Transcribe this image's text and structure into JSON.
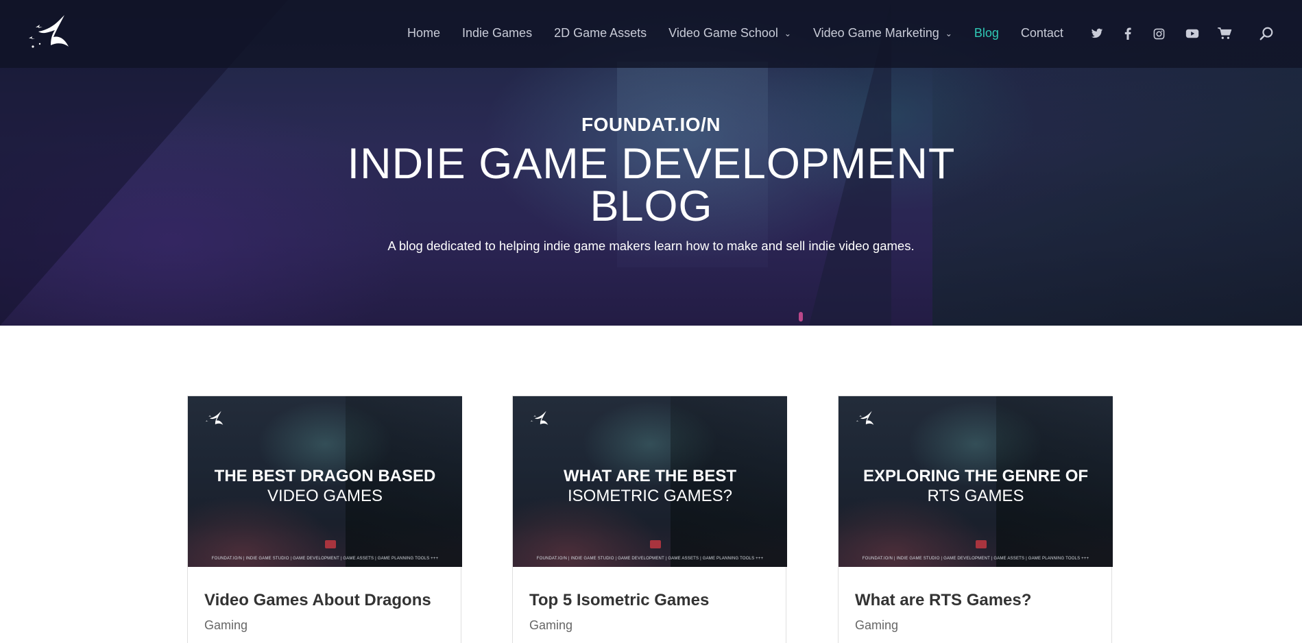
{
  "nav": {
    "items": [
      {
        "label": "Home",
        "has_dropdown": false,
        "active": false
      },
      {
        "label": "Indie Games",
        "has_dropdown": false,
        "active": false
      },
      {
        "label": "2D Game Assets",
        "has_dropdown": false,
        "active": false
      },
      {
        "label": "Video Game School",
        "has_dropdown": true,
        "active": false
      },
      {
        "label": "Video Game Marketing",
        "has_dropdown": true,
        "active": false
      },
      {
        "label": "Blog",
        "has_dropdown": false,
        "active": true
      },
      {
        "label": "Contact",
        "has_dropdown": false,
        "active": false
      }
    ],
    "chevron": "chevron-down-icon",
    "social_icons": [
      "twitter-icon",
      "facebook-icon",
      "instagram-icon",
      "youtube-icon",
      "cart-icon",
      "search-icon"
    ],
    "active_color": "#2fc9b5",
    "text_color": "#c9ccd8"
  },
  "hero": {
    "eyebrow": "FOUNDAT.IO/N",
    "title_line1": "INDIE GAME DEVELOPMENT",
    "title_line2": "BLOG",
    "subtitle": "A blog dedicated to helping indie game makers learn how to make and sell indie video games."
  },
  "cards": [
    {
      "image_line1": "THE BEST DRAGON BASED",
      "image_line2": "VIDEO GAMES",
      "image_footer": "FOUNDAT.IO/N | INDIE GAME STUDIO | GAME DEVELOPMENT | GAME ASSETS | GAME PLANNING TOOLS +++",
      "title": "Video Games About Dragons",
      "category": "Gaming"
    },
    {
      "image_line1": "WHAT ARE THE BEST",
      "image_line2": "ISOMETRIC GAMES?",
      "image_footer": "FOUNDAT.IO/N | INDIE GAME STUDIO | GAME DEVELOPMENT | GAME ASSETS | GAME PLANNING TOOLS +++",
      "title": "Top 5 Isometric Games",
      "category": "Gaming"
    },
    {
      "image_line1": "EXPLORING THE GENRE OF",
      "image_line2": "RTS GAMES",
      "image_footer": "FOUNDAT.IO/N | INDIE GAME STUDIO | GAME DEVELOPMENT | GAME ASSETS | GAME PLANNING TOOLS +++",
      "title": "What are RTS Games?",
      "category": "Gaming"
    }
  ]
}
